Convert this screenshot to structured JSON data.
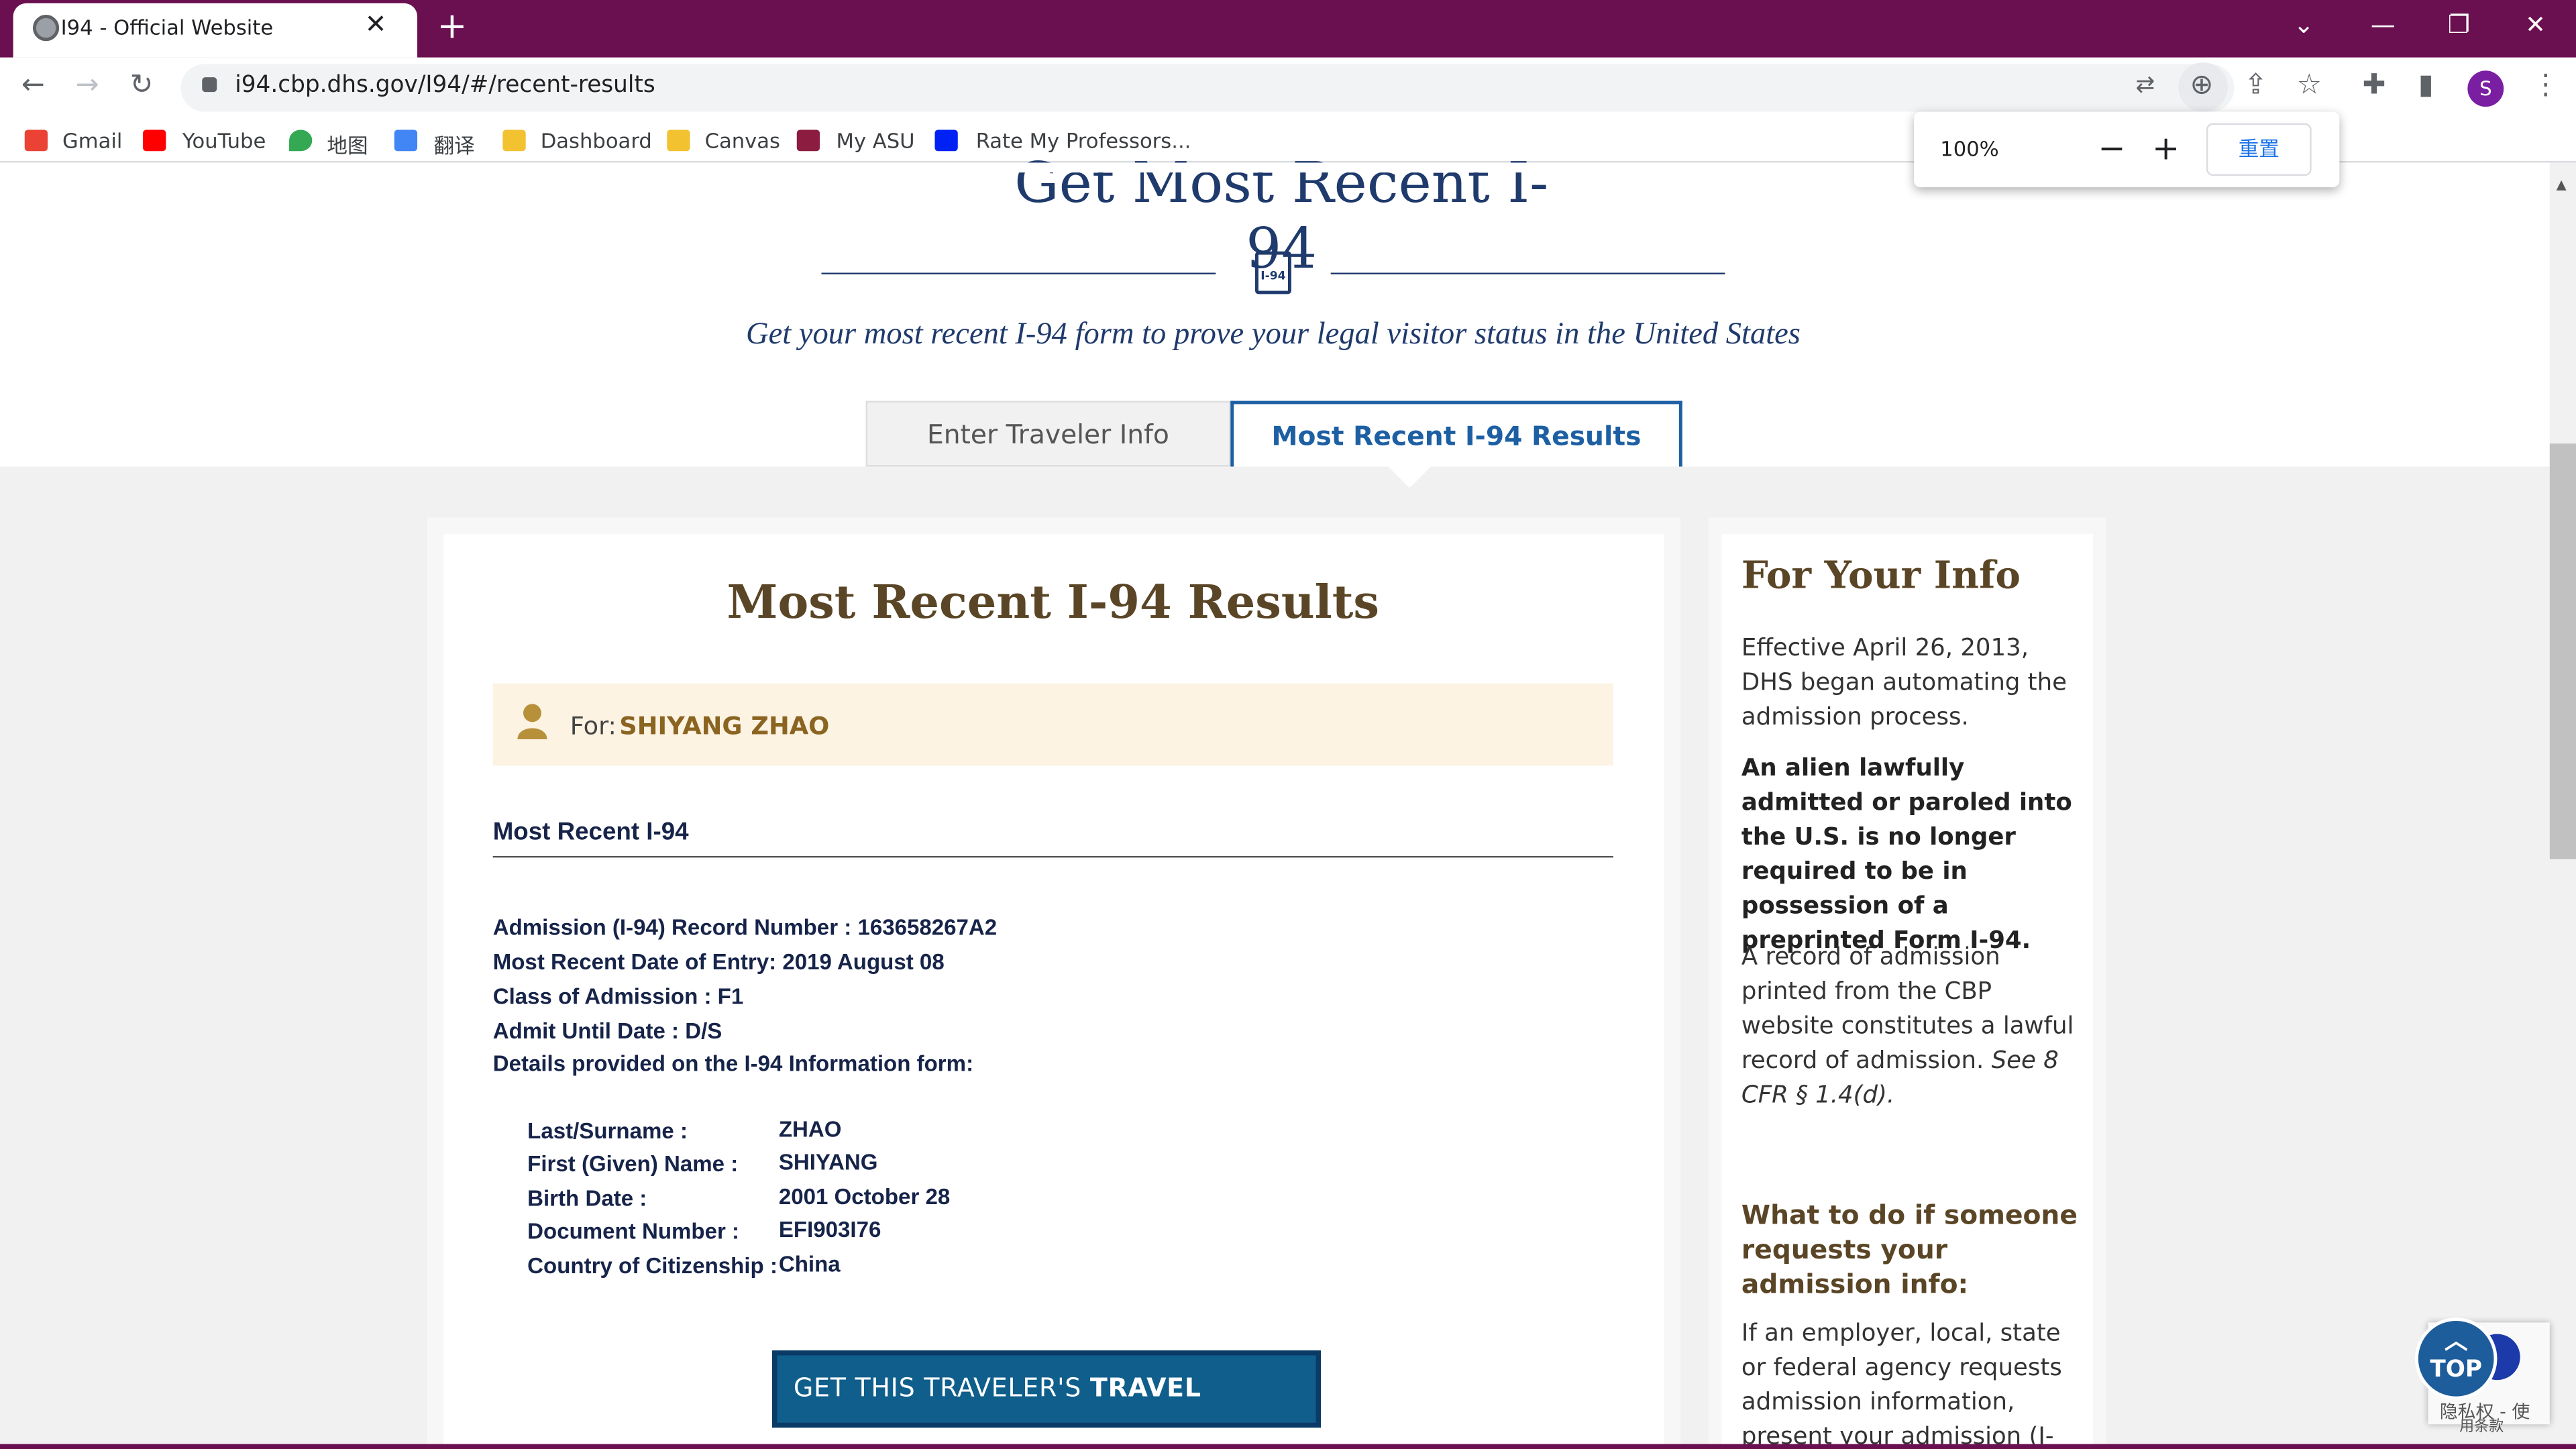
{
  "browser": {
    "tab_title": "I94 - Official Website",
    "url": "i94.cbp.dhs.gov/I94/#/recent-results",
    "profile_initial": "S",
    "bookmarks": [
      "Gmail",
      "YouTube",
      "地图",
      "翻译",
      "Dashboard",
      "Canvas",
      "My ASU",
      "Rate My Professors..."
    ],
    "zoom": {
      "level": "100%",
      "reset_label": "重置"
    }
  },
  "header": {
    "page_title": "Get Most Recent I-94",
    "form_badge": "I-94",
    "subtitle": "Get your most recent I-94 form to prove your legal visitor status in the United States",
    "tabs": [
      "Enter Traveler Info",
      "Most Recent I-94 Results"
    ]
  },
  "results": {
    "title": "Most Recent I-94 Results",
    "for_label": "For:",
    "traveler_name": "SHIYANG ZHAO",
    "section_title": "Most Recent I-94",
    "records": [
      "Admission (I-94) Record Number : 163658267A2",
      "Most Recent Date of Entry: 2019 August 08",
      "Class of Admission : F1",
      "Admit Until Date : D/S",
      "Details provided on the I-94 Information form:"
    ],
    "details": [
      {
        "label": "Last/Surname :",
        "value": "ZHAO"
      },
      {
        "label": "First (Given) Name :",
        "value": "SHIYANG"
      },
      {
        "label": "Birth Date :",
        "value": "2001 October 28"
      },
      {
        "label": "Document Number :",
        "value": "EFI903I76"
      },
      {
        "label": "Country of Citizenship :",
        "value": "China"
      }
    ],
    "travel_button_prefix": "GET THIS TRAVELER'S",
    "travel_button_bold": "TRAVEL HISTORY"
  },
  "sidebar": {
    "title": "For Your Info",
    "p1": "Effective April 26, 2013, DHS began automating the admission process.",
    "p2": "An alien lawfully admitted or paroled into the U.S. is no longer required to be in possession of a preprinted Form I-94.",
    "p3": "A record of admission printed from the CBP website constitutes a lawful record of admission.",
    "p3_cite": "See 8 CFR § 1.4(d).",
    "h2": "What to do if someone requests your admission info:",
    "p4": "If an employer, local, state or federal agency requests admission information, present your admission (I-"
  },
  "overlay": {
    "top_label": "TOP",
    "privacy": "隐私权 - 使",
    "terms": "用条款"
  }
}
